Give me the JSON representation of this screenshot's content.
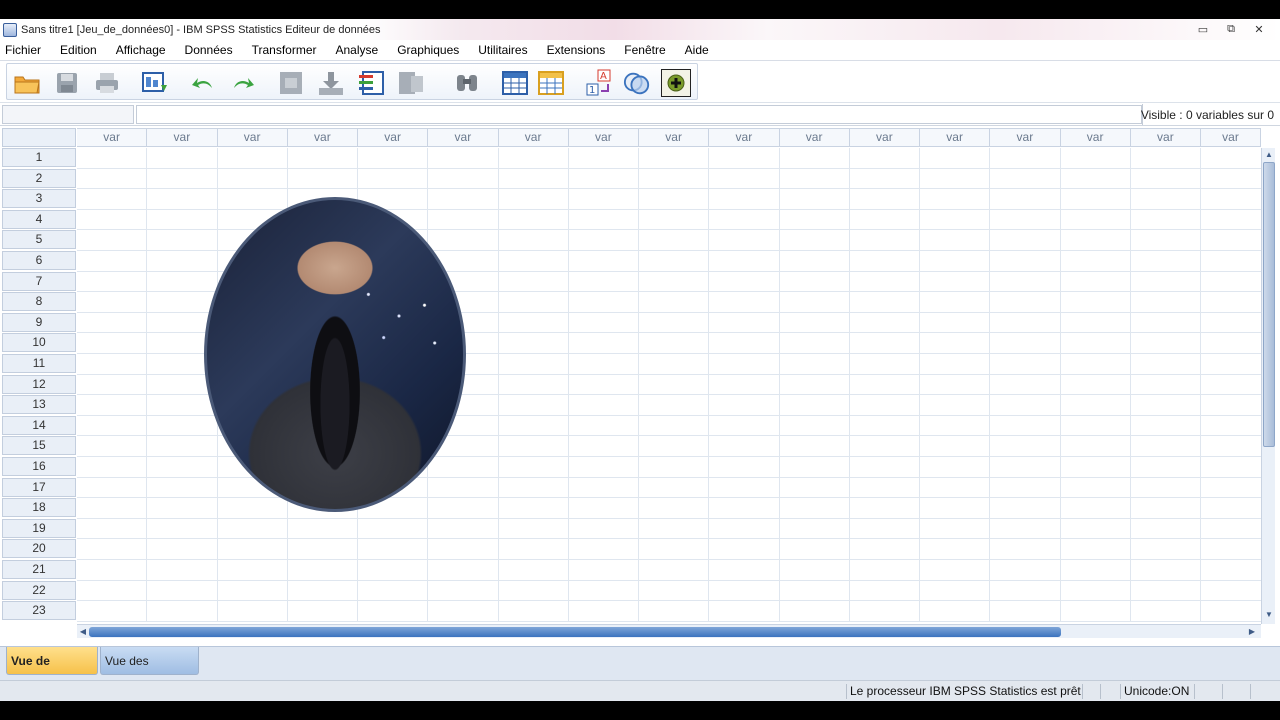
{
  "window": {
    "title": "Sans titre1 [Jeu_de_données0] - IBM SPSS Statistics Editeur de données",
    "controls": {
      "minimize": "▭",
      "restore": "⧉",
      "close": "✕"
    }
  },
  "menu": {
    "items": [
      "Fichier",
      "Edition",
      "Affichage",
      "Données",
      "Transformer",
      "Analyse",
      "Graphiques",
      "Utilitaires",
      "Extensions",
      "Fenêtre",
      "Aide"
    ]
  },
  "toolbar": {
    "icons": [
      "open-folder-icon",
      "save-icon",
      "print-icon",
      "recall-dialog-icon",
      "undo-icon",
      "redo-icon",
      "goto-case-icon",
      "goto-variable-icon",
      "variables-icon",
      "run-descriptives-icon",
      "find-icon",
      "insert-cases-icon",
      "insert-variable-icon",
      "value-labels-icon",
      "use-sets-icon",
      "spelling-icon"
    ]
  },
  "cellbar": {
    "cell_reference": "",
    "cell_value": "",
    "visible_label": "Visible : 0 variables sur 0"
  },
  "grid": {
    "column_header": "var",
    "column_count": 17,
    "rows": [
      "1",
      "2",
      "3",
      "4",
      "5",
      "6",
      "7",
      "8",
      "9",
      "10",
      "11",
      "12",
      "13",
      "14",
      "15",
      "16",
      "17",
      "18",
      "19",
      "20",
      "21",
      "22",
      "23"
    ]
  },
  "scroll": {
    "horizontal_position": 0,
    "vertical_position": 0
  },
  "tabs": {
    "data_view": "Vue de données",
    "variable_view": "Vue des variables",
    "active": "data_view"
  },
  "statusbar": {
    "processor": "Le processeur IBM SPSS Statistics  est prêt",
    "unicode": "Unicode:ON"
  },
  "colors": {
    "active_tab": "#f6c14a",
    "inactive_tab": "#9fbde3",
    "grid_line": "#dfe6ef",
    "header_text": "#6b7a8e"
  }
}
